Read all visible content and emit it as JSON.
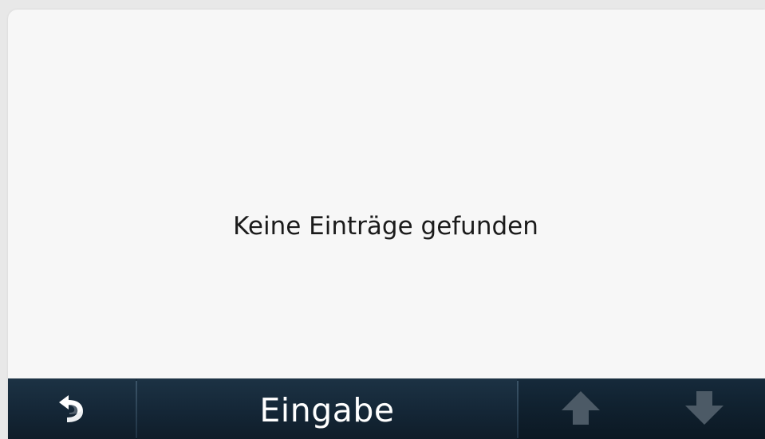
{
  "main": {
    "empty_message": "Keine Einträge gefunden"
  },
  "toolbar": {
    "back_icon": "back-arrow-icon",
    "input_label": "Eingabe",
    "up_icon": "arrow-up-icon",
    "down_icon": "arrow-down-icon"
  },
  "colors": {
    "background": "#f7f7f7",
    "toolbar": "#10212f",
    "text": "#1b1b1b",
    "disabled_arrow": "#4c5a66"
  }
}
